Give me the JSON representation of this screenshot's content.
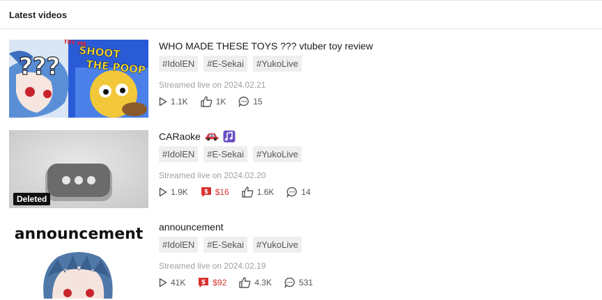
{
  "header": {
    "title": "Latest videos"
  },
  "videos": [
    {
      "title": "WHO MADE THESE TOYS ??? vtuber toy review",
      "tags": [
        "#IdolEN",
        "#E-Sekai",
        "#YukoLive"
      ],
      "date": "Streamed live on 2024.02.21",
      "views": "1.1K",
      "likes": "1K",
      "comments": "15",
      "thumb": {
        "marks": "???",
        "box_text_1": "SHOOT",
        "box_text_2": "THE POOP",
        "brand": "TRY ME"
      }
    },
    {
      "title": "CARaoke",
      "title_emojis": [
        "car-emoji",
        "music-note-emoji"
      ],
      "tags": [
        "#IdolEN",
        "#E-Sekai",
        "#YukoLive"
      ],
      "date": "Streamed live on 2024.02.20",
      "views": "1.9K",
      "superchat": "$16",
      "likes": "1.6K",
      "comments": "14",
      "badge": "Deleted"
    },
    {
      "title": "announcement",
      "tags": [
        "#IdolEN",
        "#E-Sekai",
        "#YukoLive"
      ],
      "date": "Streamed live on 2024.02.19",
      "views": "41K",
      "superchat": "$92",
      "likes": "4.3K",
      "comments": "531",
      "thumb": {
        "caption": "announcement"
      }
    }
  ],
  "colors": {
    "superchat": "#d9312f",
    "tag_bg": "#efefef",
    "muted": "#a0a0a0"
  }
}
